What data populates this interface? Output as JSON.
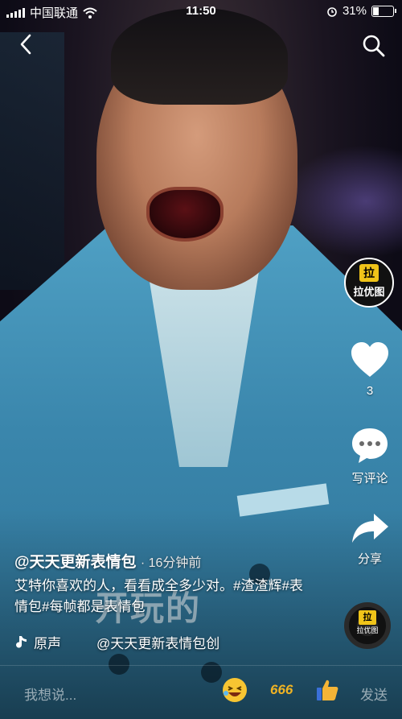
{
  "status_bar": {
    "carrier": "中国联通",
    "time": "11:50",
    "battery": "31%",
    "battery_level": 0.31
  },
  "brand": {
    "badge_char": "拉",
    "name": "拉优图"
  },
  "rail": {
    "like_count": "3",
    "comment_label": "写评论",
    "share_label": "分享"
  },
  "post": {
    "author": "@天天更新表情包",
    "time_ago": "· 16分钟前",
    "description": "艾特你喜欢的人，看看成全多少对。#渣渣辉#表情包#每帧都是表情包",
    "overlay_text": "开玩的",
    "music_label": "原声",
    "music_credit": "@天天更新表情包创"
  },
  "comment_bar": {
    "placeholder": "我想说...",
    "quick_666": "666",
    "send_label": "发送"
  },
  "colors": {
    "accent_yellow": "#f0c419",
    "suit_blue": "#3a86ac"
  }
}
